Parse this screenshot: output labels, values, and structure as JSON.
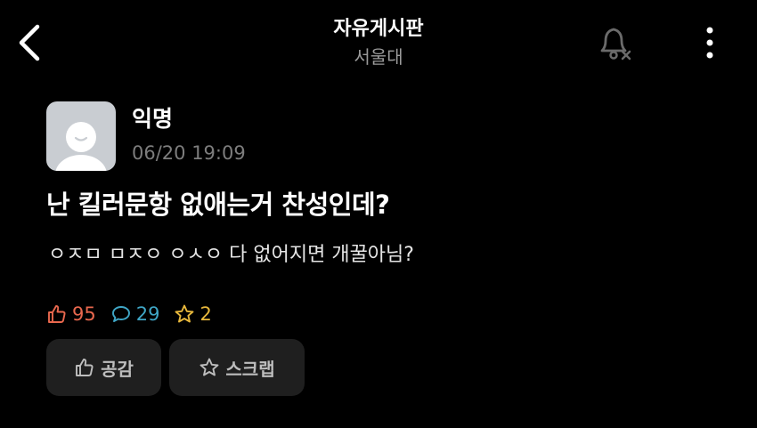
{
  "header": {
    "board_title": "자유게시판",
    "school_name": "서울대",
    "icons": {
      "back": "chevron-left-icon",
      "notification": "bell-off-icon",
      "more": "more-vertical-icon"
    }
  },
  "post": {
    "author": "익명",
    "time": "06/20 19:09",
    "title": "난 킬러문항 없애는거 찬성인데?",
    "body": "ㅇㅈㅁ ㅁㅈㅇ ㅇㅅㅇ 다 없어지면 개꿀아님?",
    "stats": {
      "likes": "95",
      "comments": "29",
      "scraps": "2"
    }
  },
  "actions": {
    "empathy_label": "공감",
    "scrap_label": "스크랩"
  },
  "colors": {
    "background": "#000000",
    "like": "#e9684e",
    "comment": "#3fa6c6",
    "scrap": "#e8b83c",
    "button_bg": "#1f1f1f",
    "muted": "#7d7d7d"
  }
}
